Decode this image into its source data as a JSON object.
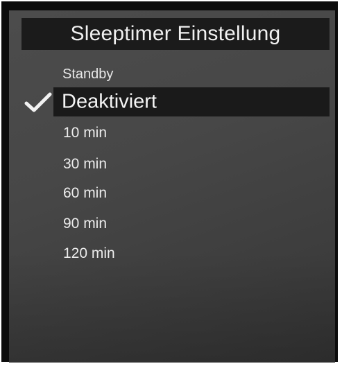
{
  "dialog": {
    "title": "Sleeptimer Einstellung",
    "section_label": "Standby"
  },
  "options": [
    {
      "label": "Deaktiviert",
      "selected": true
    },
    {
      "label": "10 min",
      "selected": false
    },
    {
      "label": "30 min",
      "selected": false
    },
    {
      "label": "60 min",
      "selected": false
    },
    {
      "label": "90 min",
      "selected": false
    },
    {
      "label": "120 min",
      "selected": false
    }
  ],
  "icons": {
    "selected_marker": "check-icon"
  },
  "colors": {
    "background": "#474747",
    "highlight": "#1a1a1a",
    "text": "#ececec"
  }
}
